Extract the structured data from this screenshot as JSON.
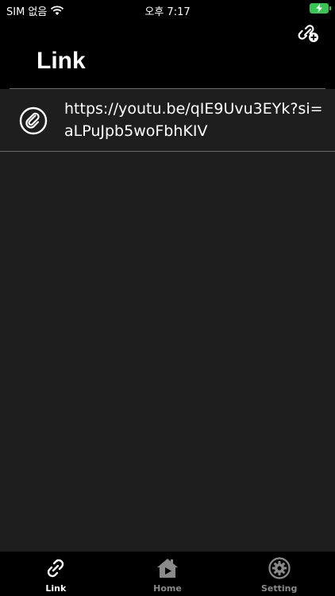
{
  "status_bar": {
    "carrier": "SIM 없음",
    "time": "오후 7:17",
    "battery_color": "#38c653"
  },
  "header": {
    "title": "Link",
    "add_icon": "add-link-icon"
  },
  "links": [
    {
      "url": "https://youtu.be/qIE9Uvu3EYk?si=aLPuJpb5woFbhKIV",
      "icon": "paperclip-icon"
    }
  ],
  "tabbar": {
    "tabs": [
      {
        "label": "Link",
        "icon": "link-icon",
        "active": true
      },
      {
        "label": "Home",
        "icon": "home-play-icon",
        "active": false
      },
      {
        "label": "Setting",
        "icon": "gear-icon",
        "active": false
      }
    ]
  }
}
